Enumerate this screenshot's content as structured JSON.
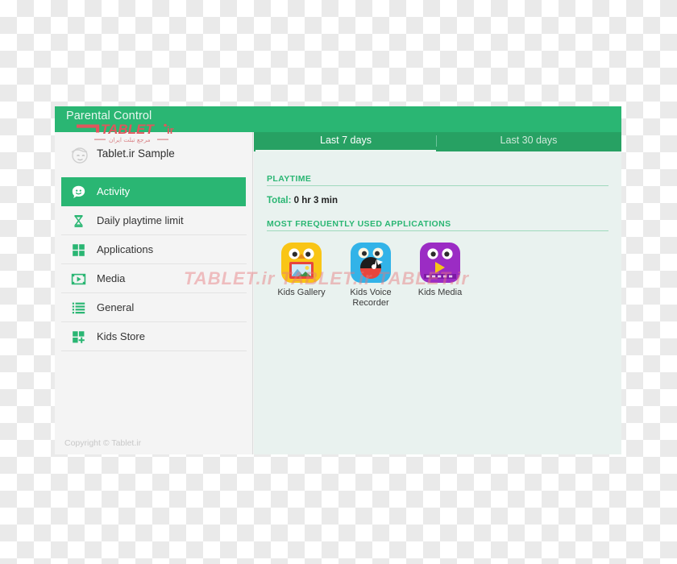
{
  "window": {
    "header_title": "Parental Control",
    "footer_copyright": "Copyright © Tablet.ir"
  },
  "profile": {
    "name": "Tablet.ir Sample",
    "avatar_icon": "kid-face-avatar-icon"
  },
  "sidebar": {
    "items": [
      {
        "label": "Activity",
        "icon": "smiley-chat-bubble-icon",
        "active": true
      },
      {
        "label": "Daily playtime limit",
        "icon": "hourglass-icon",
        "active": false
      },
      {
        "label": "Applications",
        "icon": "four-squares-grid-icon",
        "active": false
      },
      {
        "label": "Media",
        "icon": "film-play-icon",
        "active": false
      },
      {
        "label": "General",
        "icon": "list-lines-icon",
        "active": false
      },
      {
        "label": "Kids Store",
        "icon": "grid-plus-icon",
        "active": false
      }
    ]
  },
  "content": {
    "tabs": [
      {
        "label": "Last 7 days",
        "active": true
      },
      {
        "label": "Last 30 days",
        "active": false
      }
    ],
    "playtime": {
      "section_title": "PLAYTIME",
      "total_label": "Total:",
      "total_value": "0 hr 3 min"
    },
    "applications": {
      "section_title": "MOST FREQUENTLY USED APPLICATIONS",
      "items": [
        {
          "label": "Kids Gallery",
          "icon": "kids-gallery-app-icon",
          "color": "#f9c516"
        },
        {
          "label": "Kids Voice Recorder",
          "icon": "kids-voice-recorder-app-icon",
          "color": "#32b3e8"
        },
        {
          "label": "Kids Media",
          "icon": "kids-media-app-icon",
          "color": "#9b2cc4"
        }
      ]
    }
  },
  "watermark": {
    "brand": "TABLET",
    "suffix": ".ir",
    "subtitle": "مرجع تبلت ایران",
    "strip_text": "TABLET.ir    TABLET.ir    TABLET.ir"
  },
  "colors": {
    "header_green": "#2ab673",
    "tabbar_green": "#27a163",
    "content_bg": "#e9f2ef",
    "sidebar_bg": "#f4f4f4",
    "accent_green": "#2ab673",
    "watermark_pink": "#e6787d"
  }
}
